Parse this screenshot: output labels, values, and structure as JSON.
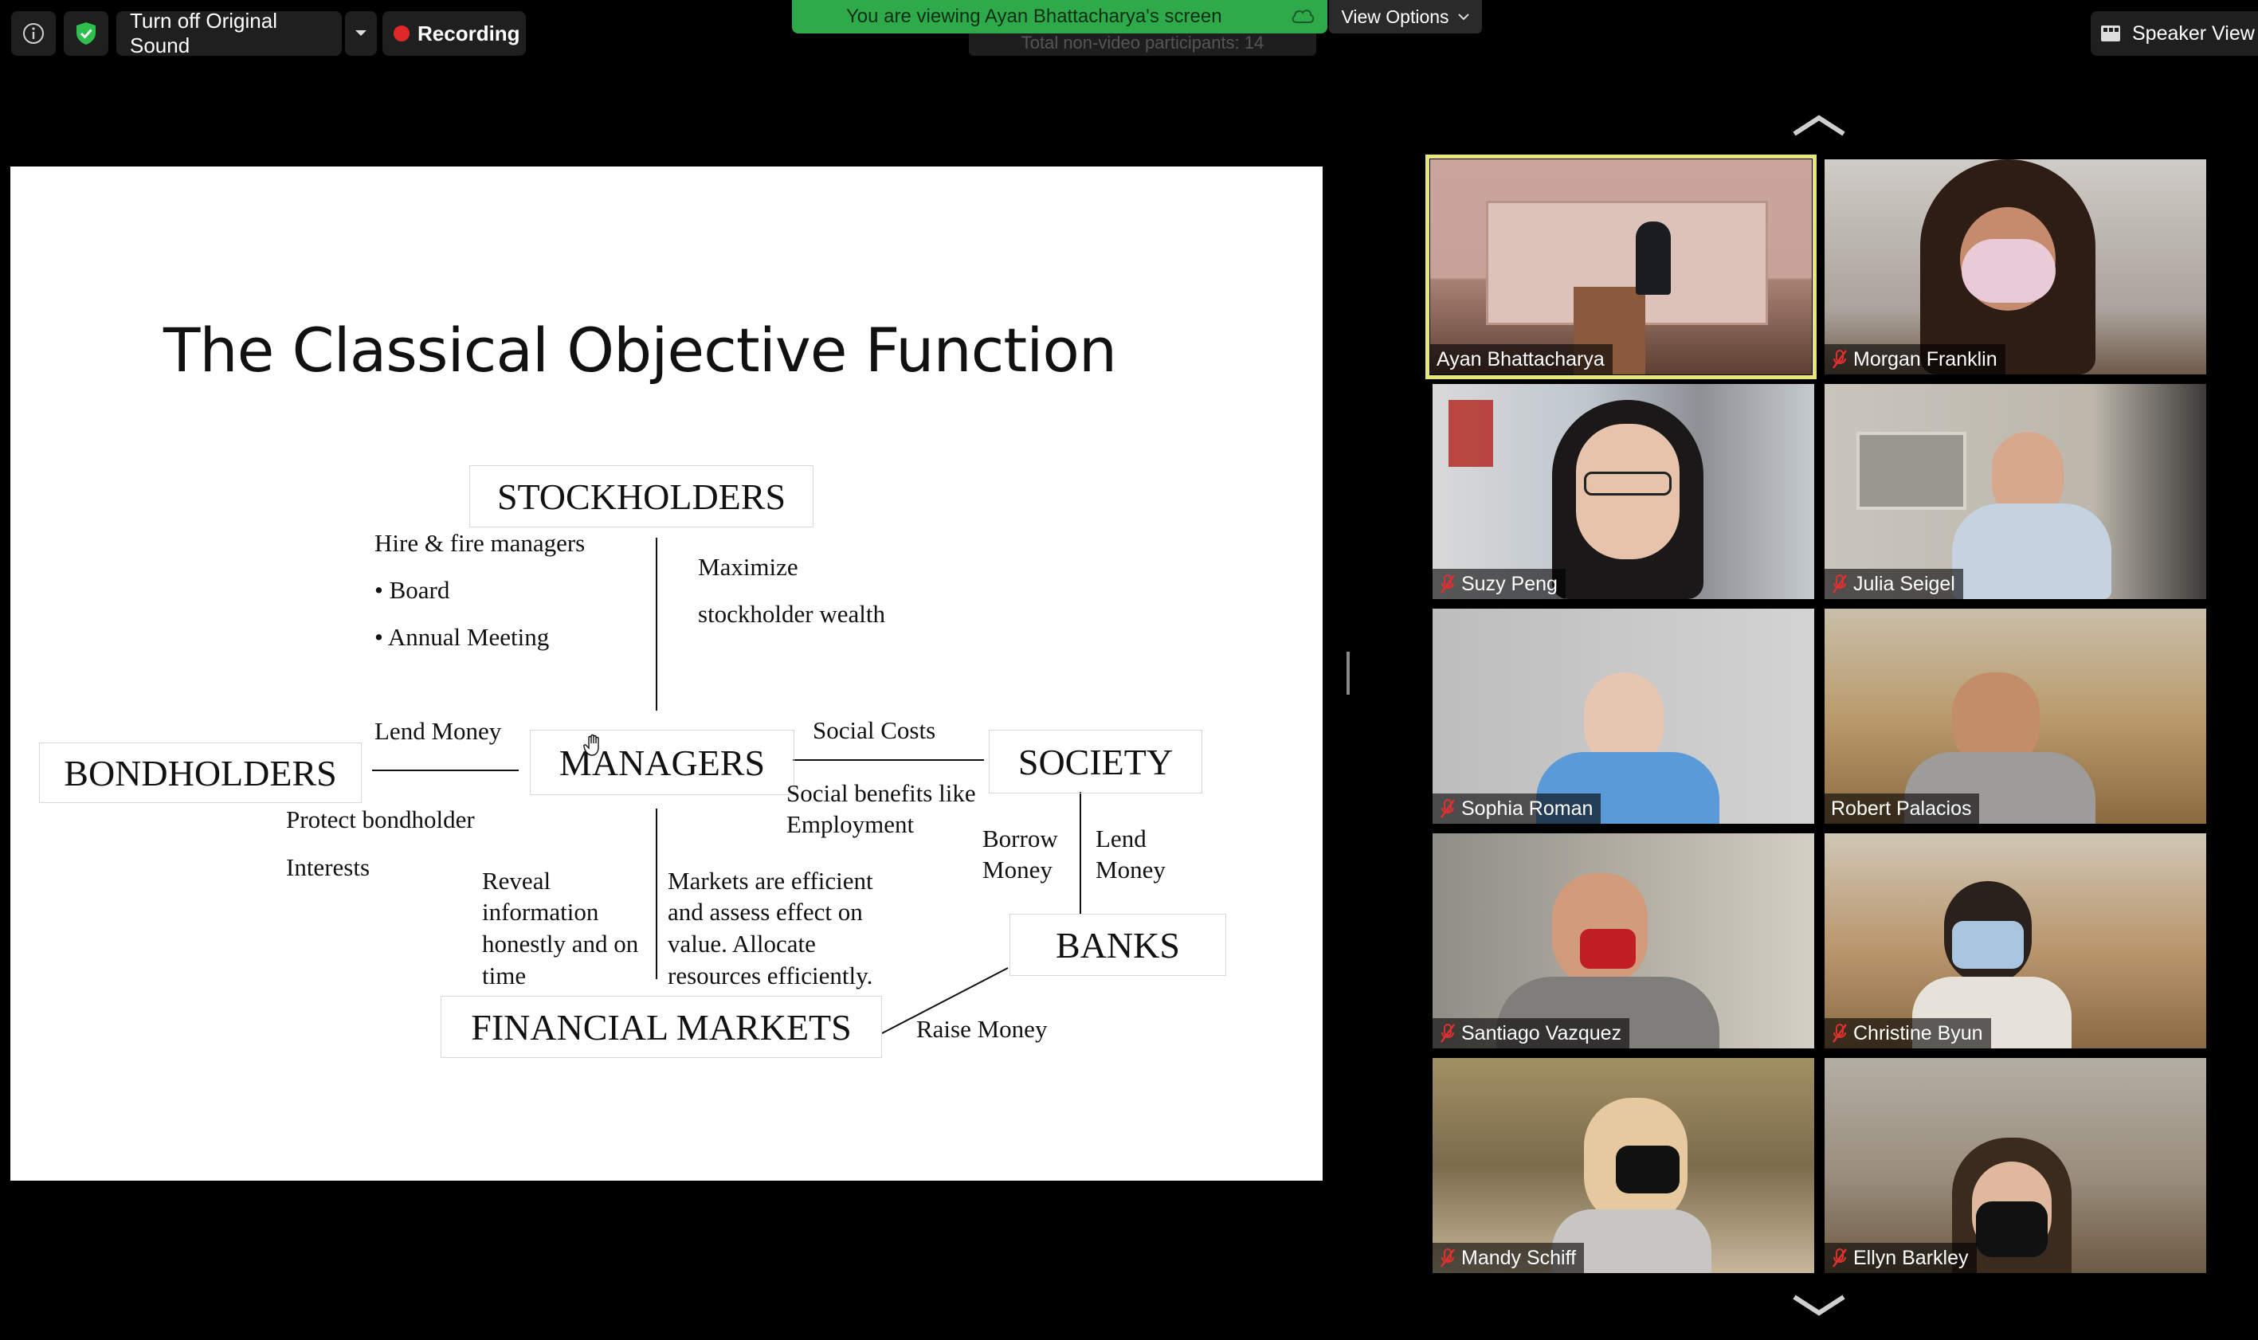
{
  "toolbar": {
    "original_sound_label": "Turn off Original Sound",
    "recording_label": "Recording",
    "banner_text": "You are viewing Ayan Bhattacharya's screen",
    "hidden_text": "Total non-video participants: 14",
    "view_options_label": "View Options",
    "speaker_view_label": "Speaker View"
  },
  "slide": {
    "title": "The Classical Objective Function",
    "stockholders": "STOCKHOLDERS",
    "managers": "MANAGERS",
    "bondholders": "BONDHOLDERS",
    "society": "SOCIETY",
    "banks": "BANKS",
    "financial_markets": "FINANCIAL MARKETS",
    "hire_fire": "Hire & fire managers",
    "board": "• Board",
    "annual_meeting": "• Annual Meeting",
    "maximize": "Maximize",
    "stockholder_wealth": "stockholder wealth",
    "lend_money_left": "Lend Money",
    "protect": "Protect bondholder",
    "interests": "Interests",
    "social_costs": "Social Costs",
    "social_benefits_1": "Social benefits like",
    "social_benefits_2": "Employment",
    "borrow_1": "Borrow",
    "borrow_2": "Money",
    "lend_1": "Lend",
    "lend_2": "Money",
    "reveal_1": "Reveal",
    "reveal_2": "information",
    "reveal_3": "honestly and on",
    "reveal_4": "time",
    "markets_1": "Markets are efficient",
    "markets_2": "and assess effect on",
    "markets_3": "value. Allocate",
    "markets_4": "resources efficiently.",
    "raise_money": "Raise Money"
  },
  "participants": [
    {
      "name": "Ayan Bhattacharya",
      "muted": false,
      "active_speaker": true
    },
    {
      "name": "Morgan Franklin",
      "muted": true
    },
    {
      "name": "Suzy Peng",
      "muted": true
    },
    {
      "name": "Julia Seigel",
      "muted": true
    },
    {
      "name": "Sophia Roman",
      "muted": true
    },
    {
      "name": "Robert Palacios",
      "muted": false
    },
    {
      "name": "Santiago Vazquez",
      "muted": true
    },
    {
      "name": "Christine Byun",
      "muted": true
    },
    {
      "name": "Mandy Schiff",
      "muted": true
    },
    {
      "name": "Ellyn Barkley",
      "muted": true
    }
  ],
  "colors": {
    "banner": "#2eaa4a",
    "active_speaker_outline": "#e6e67a",
    "recording_dot": "#e02828",
    "mute_icon": "#e03030"
  }
}
